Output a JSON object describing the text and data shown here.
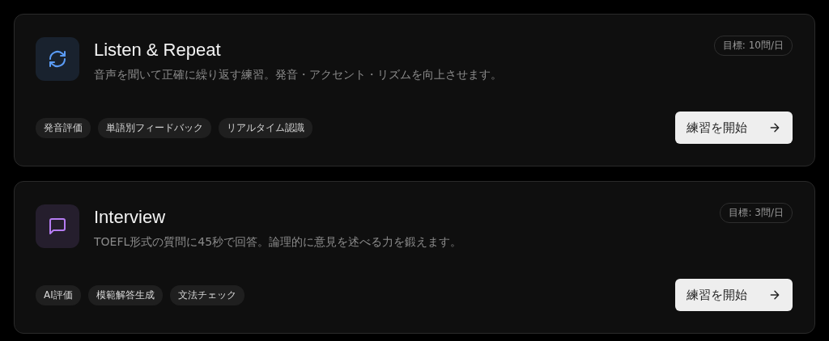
{
  "cards": [
    {
      "icon": {
        "kind": "refresh",
        "color": "#5b9cf6"
      },
      "title": "Listen & Repeat",
      "description": "音声を聞いて正確に繰り返す練習。発音・アクセント・リズムを向上させます。",
      "goal": "目標: 10問/日",
      "tags": [
        "発音評価",
        "単語別フィードバック",
        "リアルタイム認識"
      ],
      "button": "練習を開始"
    },
    {
      "icon": {
        "kind": "chat",
        "color": "#b57cf2"
      },
      "title": "Interview",
      "description": "TOEFL形式の質問に45秒で回答。論理的に意見を述べる力を鍛えます。",
      "goal": "目標: 3問/日",
      "tags": [
        "AI評価",
        "模範解答生成",
        "文法チェック"
      ],
      "button": "練習を開始"
    }
  ]
}
